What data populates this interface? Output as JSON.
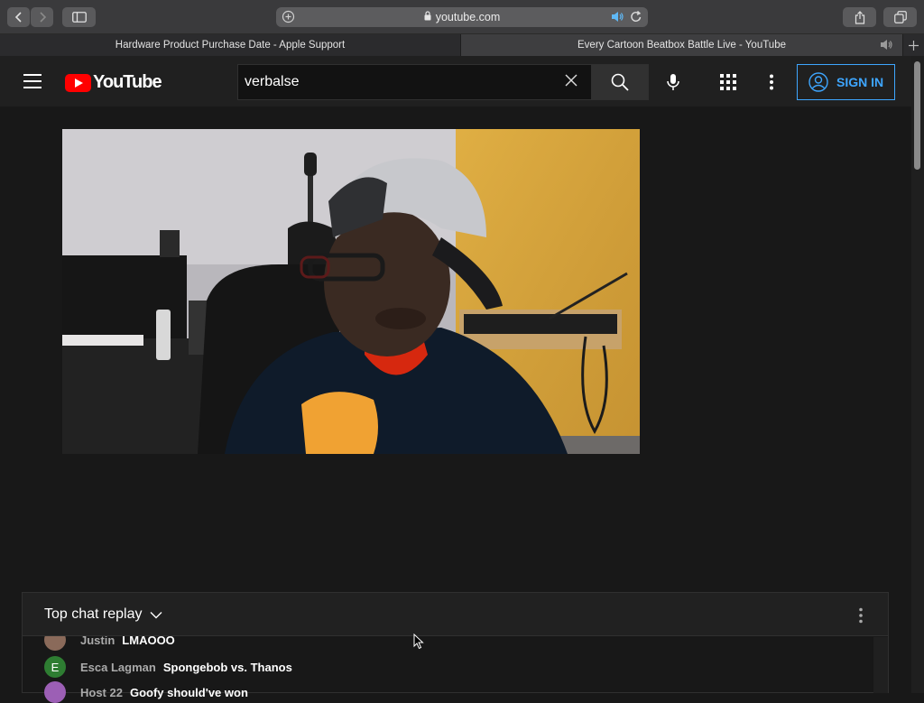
{
  "browser": {
    "address": "youtube.com",
    "tabs": [
      {
        "title": "Hardware Product Purchase Date - Apple Support"
      },
      {
        "title": "Every Cartoon Beatbox Battle Live - YouTube"
      }
    ]
  },
  "youtube": {
    "logo_text": "YouTube",
    "search_value": "verbalse",
    "signin_label": "SIGN IN"
  },
  "chat": {
    "header": "Top chat replay",
    "messages": [
      {
        "author": "Justin",
        "text": "LMAOOO",
        "avatar_letter": "",
        "avatar_color": "#8a6a5a"
      },
      {
        "author": "Esca Lagman",
        "text": "Spongebob vs. Thanos",
        "avatar_letter": "E",
        "avatar_color": "#2e7d32"
      },
      {
        "author": "Host 22",
        "text": "Goofy should've won",
        "avatar_letter": "",
        "avatar_color": "#9c5fb5"
      }
    ]
  },
  "colors": {
    "accent": "#3ea6ff",
    "brand_red": "#ff0000",
    "background": "#181818"
  }
}
